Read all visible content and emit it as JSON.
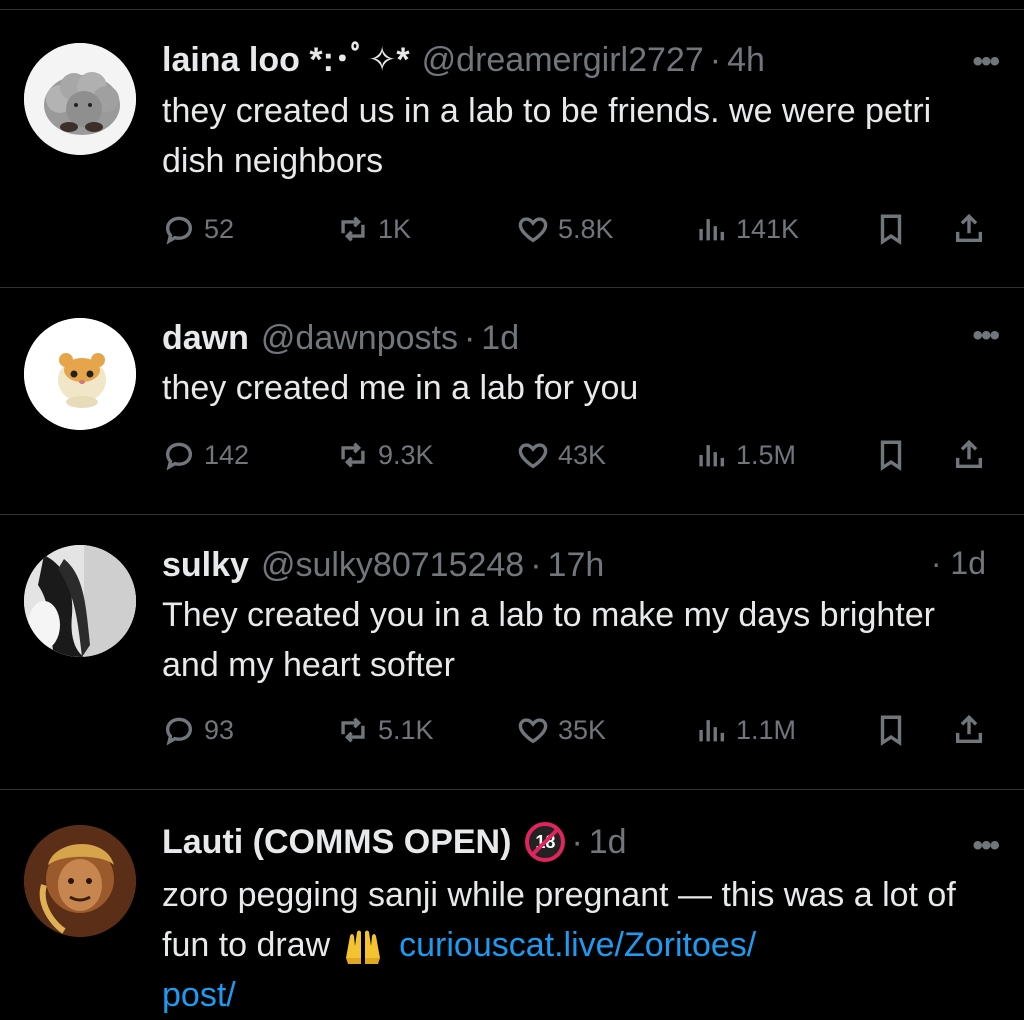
{
  "tweets": [
    {
      "name": "laina loo *:･ﾟ✧*",
      "handle": "@dreamergirl2727",
      "time": "4h",
      "text": "they created us in a lab to be friends. we were petri dish neighbors",
      "replies": "52",
      "reposts": "1K",
      "likes": "5.8K",
      "views": "141K",
      "avatar": "fluffy-gray-plush-avatar"
    },
    {
      "name": "dawn",
      "handle": "@dawnposts",
      "time": "1d",
      "text": "they created me in a lab for you",
      "replies": "142",
      "reposts": "9.3K",
      "likes": "43K",
      "views": "1.5M",
      "avatar": "hamster-plush-avatar"
    },
    {
      "name": "sulky",
      "handle": "@sulky80715248",
      "time": "17h",
      "side_time": "· 1d",
      "text": "They created you in a lab to make my days brighter and my heart softer",
      "replies": "93",
      "reposts": "5.1K",
      "likes": "35K",
      "views": "1.1M",
      "avatar": "dark-hair-photo-avatar"
    },
    {
      "name": "Lauti (COMMS OPEN)",
      "badge": "18",
      "time": "1d",
      "text_before_link": "zoro pegging sanji while pregnant — this was a lot of fun to draw",
      "emoji": "raising-hands-emoji",
      "link": "curiouscat.live/Zoritoes/",
      "link_cont": "post/",
      "avatar": "illustrated-portrait-avatar"
    }
  ],
  "colors": {
    "background": "#000000",
    "text": "#e7e9ea",
    "muted": "#71767b",
    "link": "#1d9bf0",
    "divider": "#2f3336"
  }
}
